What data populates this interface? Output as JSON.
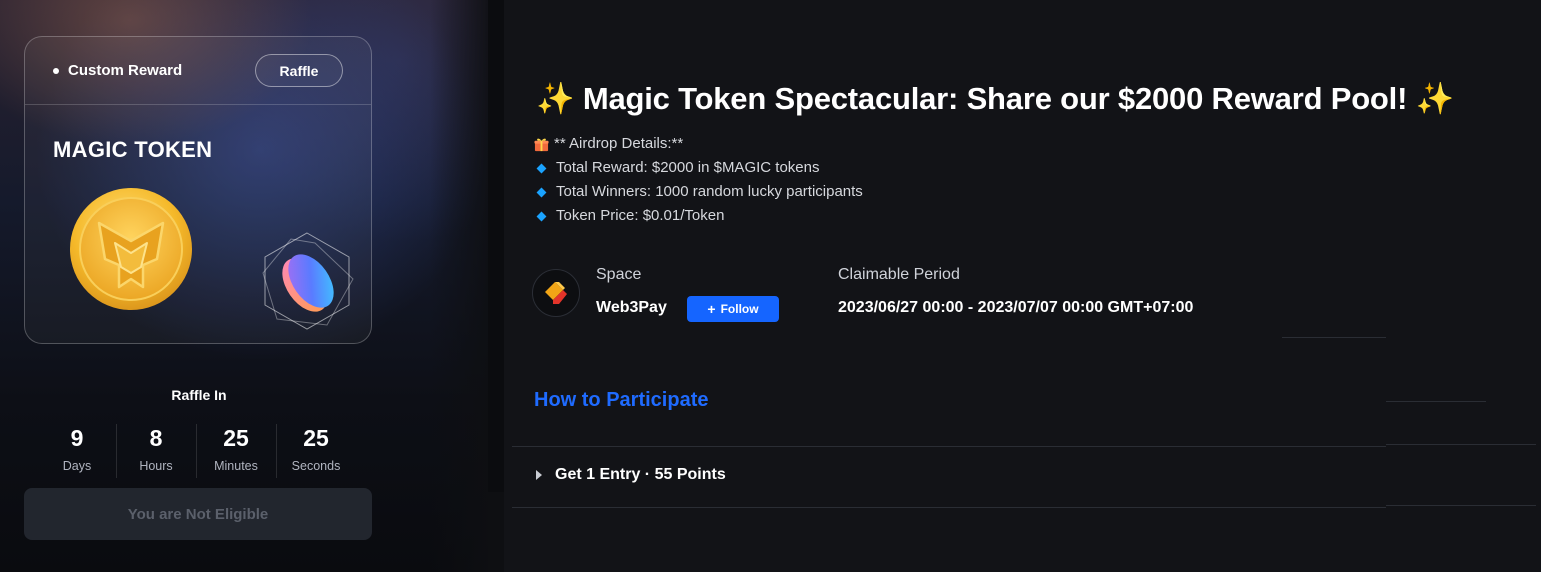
{
  "reward_card": {
    "reward_type": "Custom Reward",
    "method_badge": "Raffle",
    "token_name": "MAGIC TOKEN"
  },
  "countdown": {
    "heading": "Raffle In",
    "units": [
      {
        "value": "9",
        "label": "Days"
      },
      {
        "value": "8",
        "label": "Hours"
      },
      {
        "value": "25",
        "label": "Minutes"
      },
      {
        "value": "25",
        "label": "Seconds"
      }
    ]
  },
  "eligibility_button": "You are Not Eligible",
  "campaign": {
    "title": "Magic Token Spectacular: Share our $2000 Reward Pool!",
    "title_emoji": "✨",
    "details_header": "** Airdrop Details:**",
    "details": [
      "Total Reward: $2000 in $MAGIC tokens",
      "Total Winners: 1000 random lucky participants",
      "Token Price: $0.01/Token"
    ]
  },
  "space": {
    "label": "Space",
    "name": "Web3Pay",
    "follow_label": "Follow",
    "follow_icon": "plus-icon"
  },
  "claimable": {
    "label": "Claimable Period",
    "value": "2023/06/27 00:00 - 2023/07/07 00:00 GMT+07:00"
  },
  "how_to_participate": "How to Participate",
  "tasks": [
    {
      "label": "Get 1 Entry · 55 Points",
      "icon": "caret-right-icon"
    }
  ],
  "colors": {
    "accent_blue": "#1565ff",
    "link_blue": "#1f6bff",
    "bullet_blue": "#1aa3ff",
    "coin_gold": "#f5b92a",
    "space_logo_orange": "#f2a516",
    "space_logo_red": "#e3342a"
  }
}
